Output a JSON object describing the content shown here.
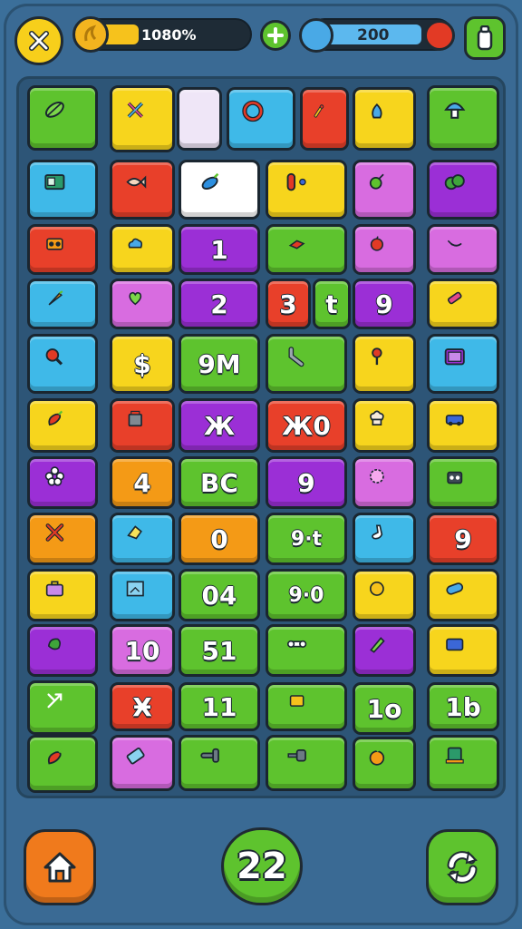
{
  "hud": {
    "coin_progress": 0.3,
    "coin_text": "1080%",
    "gem_progress": 0.82,
    "gem_text": "200"
  },
  "colors": {
    "green": "#5ec32e",
    "yellow": "#f7d51d",
    "purple": "#9b2fd6",
    "red": "#e8402a",
    "orange": "#f49a16",
    "cyan": "#3fb9e8",
    "pink": "#d86ce0",
    "white": "#ffffff",
    "light": "#efe6f7"
  },
  "tiles": [
    {
      "id": "leaf",
      "color": "green",
      "icon": "leaf-icon"
    },
    {
      "id": "tools",
      "color": "yellow",
      "icon": "crossed-tools-icon"
    },
    {
      "id": "blank-1",
      "color": "light",
      "icon": ""
    },
    {
      "id": "ring",
      "color": "cyan",
      "icon": "ring-icon"
    },
    {
      "id": "brush",
      "color": "red",
      "icon": "brush-icon"
    },
    {
      "id": "bottle",
      "color": "yellow",
      "icon": "bottle-icon"
    },
    {
      "id": "mushroom",
      "color": "green",
      "icon": "mushroom-icon"
    },
    {
      "id": "radio",
      "color": "cyan",
      "icon": "radio-icon"
    },
    {
      "id": "fish",
      "color": "red",
      "icon": "fish-icon"
    },
    {
      "id": "feather",
      "color": "white",
      "icon": "feather-icon"
    },
    {
      "id": "switch",
      "color": "yellow",
      "icon": "switch-icon"
    },
    {
      "id": "grape",
      "color": "pink",
      "icon": "grape-icon"
    },
    {
      "id": "bush",
      "color": "purple",
      "icon": "bush-icon"
    },
    {
      "id": "boombox",
      "color": "red",
      "icon": "boombox-icon"
    },
    {
      "id": "cloud",
      "color": "yellow",
      "icon": "cloud-icon"
    },
    {
      "id": "n1",
      "color": "purple",
      "text": "1"
    },
    {
      "id": "brick",
      "color": "green",
      "icon": "brick-icon"
    },
    {
      "id": "apple",
      "color": "pink",
      "icon": "apple-icon"
    },
    {
      "id": "banana",
      "color": "pink",
      "icon": "banana-icon"
    },
    {
      "id": "carrot",
      "color": "cyan",
      "icon": "carrot-icon"
    },
    {
      "id": "heart",
      "color": "pink",
      "icon": "heart-icon"
    },
    {
      "id": "n2",
      "color": "purple",
      "text": "2"
    },
    {
      "id": "n3",
      "color": "red",
      "text": "3"
    },
    {
      "id": "nt",
      "color": "green",
      "text": "t"
    },
    {
      "id": "n9a",
      "color": "purple",
      "text": "9"
    },
    {
      "id": "candy",
      "color": "yellow",
      "icon": "candy-icon"
    },
    {
      "id": "meat",
      "color": "cyan",
      "icon": "meat-icon"
    },
    {
      "id": "dollar",
      "color": "yellow",
      "text": "$"
    },
    {
      "id": "n9m",
      "color": "green",
      "text": "9M"
    },
    {
      "id": "pipe",
      "color": "green",
      "icon": "pipe-icon"
    },
    {
      "id": "spoon",
      "color": "yellow",
      "icon": "spoon-icon"
    },
    {
      "id": "tv",
      "color": "cyan",
      "icon": "tv-icon"
    },
    {
      "id": "pepper",
      "color": "yellow",
      "icon": "pepper-icon"
    },
    {
      "id": "bucket",
      "color": "red",
      "icon": "bucket-icon"
    },
    {
      "id": "nx",
      "color": "purple",
      "text": "Ж"
    },
    {
      "id": "n10",
      "color": "red",
      "text": "Ж0"
    },
    {
      "id": "chef",
      "color": "yellow",
      "icon": "chef-hat-icon"
    },
    {
      "id": "car",
      "color": "yellow",
      "icon": "car-icon"
    },
    {
      "id": "flower",
      "color": "purple",
      "icon": "flower-icon"
    },
    {
      "id": "n4",
      "color": "orange",
      "text": "4"
    },
    {
      "id": "nbc",
      "color": "green",
      "text": "BC"
    },
    {
      "id": "n9b",
      "color": "purple",
      "text": "9"
    },
    {
      "id": "cloud2",
      "color": "pink",
      "icon": "puff-icon"
    },
    {
      "id": "robot",
      "color": "green",
      "icon": "robot-icon"
    },
    {
      "id": "x-mark",
      "color": "orange",
      "icon": "x-mark-icon"
    },
    {
      "id": "eraser",
      "color": "cyan",
      "icon": "eraser-icon"
    },
    {
      "id": "n0",
      "color": "orange",
      "text": "0"
    },
    {
      "id": "n9t",
      "color": "green",
      "text": "9·t"
    },
    {
      "id": "sock",
      "color": "cyan",
      "icon": "sock-icon"
    },
    {
      "id": "n9c",
      "color": "red",
      "text": "9"
    },
    {
      "id": "suitcase",
      "color": "yellow",
      "icon": "suitcase-icon"
    },
    {
      "id": "frame",
      "color": "cyan",
      "icon": "frame-icon"
    },
    {
      "id": "n04",
      "color": "green",
      "text": "04"
    },
    {
      "id": "n90",
      "color": "green",
      "text": "9·0"
    },
    {
      "id": "lemon",
      "color": "yellow",
      "icon": "lemon-icon"
    },
    {
      "id": "pill",
      "color": "yellow",
      "icon": "pill-icon"
    },
    {
      "id": "bird",
      "color": "purple",
      "icon": "bird-icon"
    },
    {
      "id": "n10b",
      "color": "pink",
      "text": "10"
    },
    {
      "id": "n51",
      "color": "green",
      "text": "51"
    },
    {
      "id": "bone",
      "color": "green",
      "icon": "bone-icon"
    },
    {
      "id": "pencil",
      "color": "purple",
      "icon": "pencil-icon"
    },
    {
      "id": "box",
      "color": "yellow",
      "icon": "box-icon"
    },
    {
      "id": "arrows",
      "color": "green",
      "icon": "arrows-icon"
    },
    {
      "id": "nh",
      "color": "red",
      "text": "Ӿ"
    },
    {
      "id": "n11",
      "color": "green",
      "text": "11"
    },
    {
      "id": "wallet",
      "color": "green",
      "icon": "wallet-icon"
    },
    {
      "id": "n1o",
      "color": "green",
      "text": "1o"
    },
    {
      "id": "n1b",
      "color": "green",
      "text": "1b"
    },
    {
      "id": "pepper2",
      "color": "green",
      "icon": "pepper-icon"
    },
    {
      "id": "phone",
      "color": "pink",
      "icon": "phone-icon"
    },
    {
      "id": "hammer",
      "color": "green",
      "icon": "hammer-icon"
    },
    {
      "id": "plug",
      "color": "green",
      "icon": "plug-icon"
    },
    {
      "id": "orange-fruit",
      "color": "green",
      "icon": "orange-fruit-icon"
    },
    {
      "id": "machine",
      "color": "green",
      "icon": "machine-icon"
    }
  ],
  "bottom": {
    "home_color": "#f07a1c",
    "center_text": "22",
    "center_color": "#5ec32e",
    "refresh_color": "#5ec32e"
  }
}
